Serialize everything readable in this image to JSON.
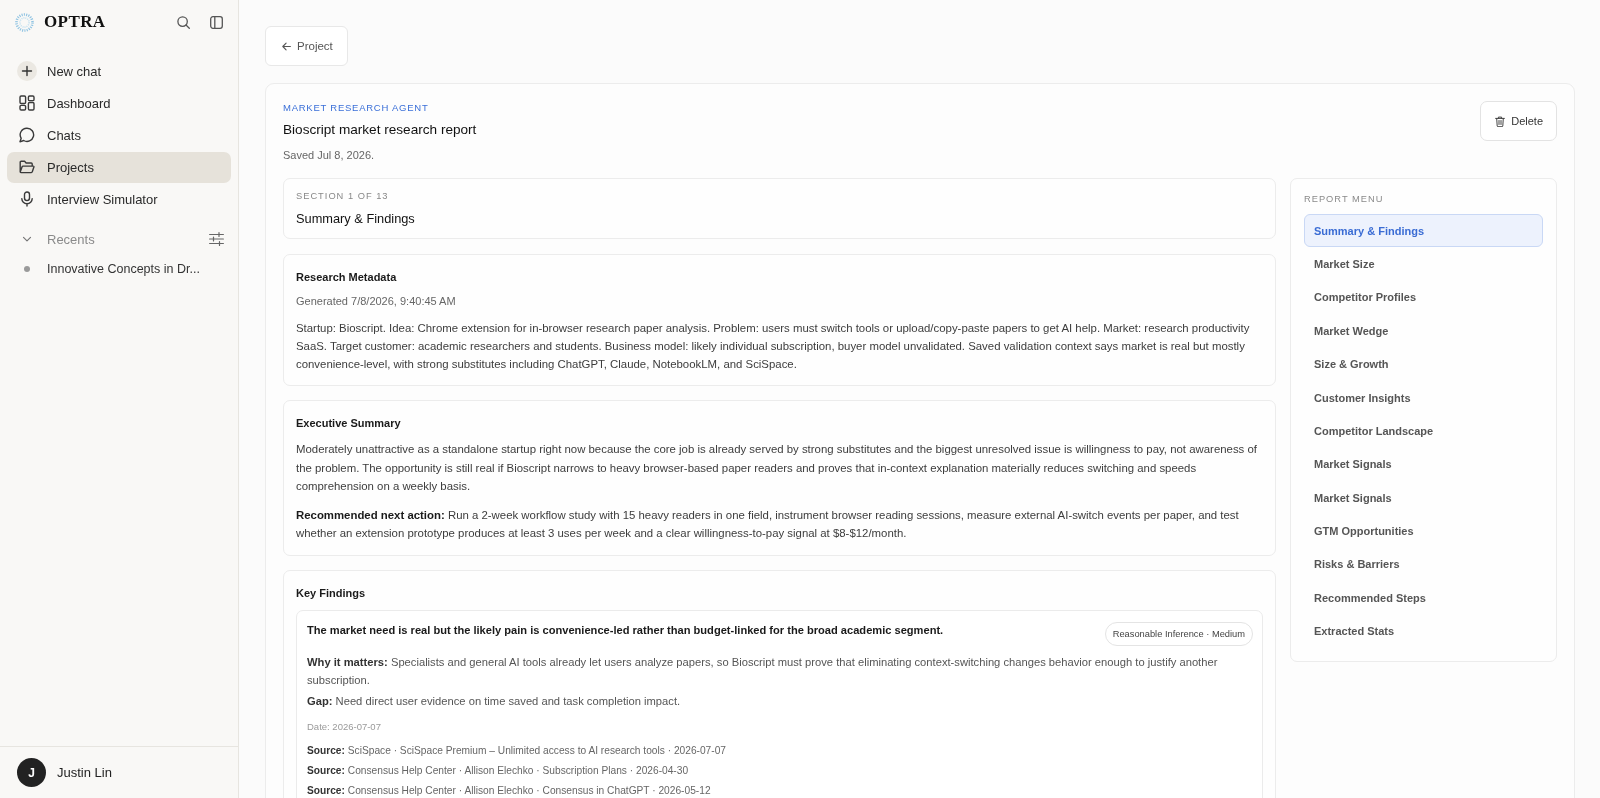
{
  "sidebar": {
    "brand": "OPTRA",
    "nav": [
      {
        "label": "New chat",
        "selected": false
      },
      {
        "label": "Dashboard",
        "selected": false
      },
      {
        "label": "Chats",
        "selected": false
      },
      {
        "label": "Projects",
        "selected": true
      },
      {
        "label": "Interview Simulator",
        "selected": false
      }
    ],
    "recents": {
      "label": "Recents",
      "expanded": true,
      "items": [
        {
          "label": "Innovative Concepts in Dr..."
        }
      ]
    },
    "user": {
      "initial": "J",
      "name": "Justin Lin"
    }
  },
  "back_button": {
    "label": "Project"
  },
  "report": {
    "agent": "MARKET RESEARCH AGENT",
    "title": "Bioscript market research report",
    "saved": "Saved Jul 8, 2026.",
    "delete_button": {
      "label": "Delete"
    },
    "section": {
      "counter": "SECTION 1 OF 13",
      "title": "Summary & Findings"
    },
    "metadata": {
      "heading": "Research Metadata",
      "generated": "Generated 7/8/2026, 9:40:45 AM",
      "text": "Startup: Bioscript. Idea: Chrome extension for in-browser research paper analysis. Problem: users must switch tools or upload/copy-paste papers to get AI help. Market: research productivity SaaS. Target customer: academic researchers and students. Business model: likely individual subscription, buyer model unvalidated. Saved validation context says market is real but mostly convenience-level, with strong substitutes including ChatGPT, Claude, NotebookLM, and SciSpace."
    },
    "executive_summary": {
      "heading": "Executive Summary",
      "paragraphs": [
        "Moderately unattractive as a standalone startup right now because the core job is already served by strong substitutes and the biggest unresolved issue is willingness to pay, not awareness of the problem. The opportunity is still real if Bioscript narrows to heavy browser-based paper readers and proves that in-context explanation materially reduces switching and speeds comprehension on a weekly basis.",
        "**Recommended next action:** Run a 2-week workflow study with 15 heavy readers in one field, instrument browser reading sessions, measure external AI-switch events per paper, and test whether an extension prototype produces at least 3 uses per week and a clear willingness-to-pay signal at $8-$12/month."
      ]
    },
    "key_findings": {
      "heading": "Key Findings",
      "findings": [
        {
          "title": "The market need is real but the likely pain is convenience-led rather than budget-linked for the broad academic segment.",
          "badge": "Reasonable Inference · Medium",
          "why": "**Why it matters:** Specialists and general AI tools already let users analyze papers, so Bioscript must prove that eliminating context-switching changes behavior enough to justify another subscription.",
          "gap": "**Gap:** Need direct user evidence on time saved and task completion impact.",
          "date": "Date: 2026-07-07",
          "sources": [
            "**Source:** SciSpace · SciSpace Premium – Unlimited access to AI research tools · 2026-07-07",
            "**Source:** Consensus Help Center · Allison Elechko · Subscription Plans · 2026-04-30",
            "**Source:** Consensus Help Center · Allison Elechko · Consensus in ChatGPT · 2026-05-12"
          ]
        }
      ]
    },
    "menu": {
      "heading": "REPORT MENU",
      "items": [
        {
          "label": "Summary & Findings",
          "selected": true
        },
        {
          "label": "Market Size",
          "selected": false
        },
        {
          "label": "Competitor Profiles",
          "selected": false
        },
        {
          "label": "Market Wedge",
          "selected": false
        },
        {
          "label": "Size & Growth",
          "selected": false
        },
        {
          "label": "Customer Insights",
          "selected": false
        },
        {
          "label": "Competitor Landscape",
          "selected": false
        },
        {
          "label": "Market Signals",
          "selected": false
        },
        {
          "label": "Market Signals",
          "selected": false
        },
        {
          "label": "GTM Opportunities",
          "selected": false
        },
        {
          "label": "Risks & Barriers",
          "selected": false
        },
        {
          "label": "Recommended Steps",
          "selected": false
        },
        {
          "label": "Extracted Stats",
          "selected": false
        }
      ]
    }
  }
}
